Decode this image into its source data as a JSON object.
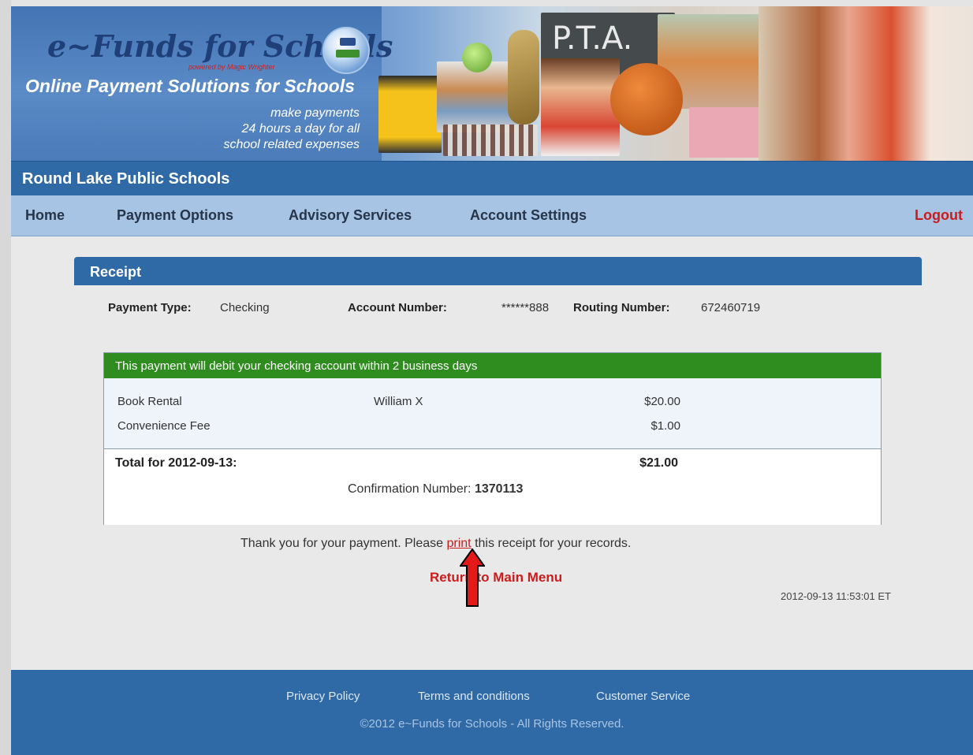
{
  "banner": {
    "logo_text": "e~Funds for Schools",
    "powered_by": "powered by Magic Wrighter",
    "tagline": "Online Payment Solutions for Schools",
    "subtitle_line1": "make payments",
    "subtitle_line2": "24 hours a day for all",
    "subtitle_line3": "school related expenses",
    "chalkboard_text": "P.T.A."
  },
  "school": {
    "name": "Round Lake Public Schools"
  },
  "nav": {
    "home": "Home",
    "payment_options": "Payment Options",
    "advisory_services": "Advisory Services",
    "account_settings": "Account Settings",
    "logout": "Logout"
  },
  "receipt": {
    "title": "Receipt",
    "payment_type_label": "Payment Type:",
    "payment_type_value": "Checking",
    "account_number_label": "Account Number:",
    "account_number_value": "******888",
    "routing_number_label": "Routing Number:",
    "routing_number_value": "672460719",
    "notice": "This payment will debit your checking account within 2 business days",
    "items": [
      {
        "name": "Book Rental",
        "student": "William X",
        "amount": "$20.00"
      },
      {
        "name": "Convenience Fee",
        "student": "",
        "amount": "$1.00"
      }
    ],
    "total_label": "Total for 2012-09-13:",
    "total_value": "$21.00",
    "confirmation_label": "Confirmation Number:",
    "confirmation_value": "1370113",
    "thanks_before": "Thank you for your payment. Please",
    "print_link": "print",
    "thanks_after": "this receipt for your records.",
    "return_link": "Return to Main Menu",
    "timestamp": "2012-09-13 11:53:01 ET"
  },
  "footer": {
    "privacy": "Privacy Policy",
    "terms": "Terms and conditions",
    "customer_service": "Customer Service",
    "copyright": "©2012 e~Funds for Schools - All Rights Reserved."
  },
  "colors": {
    "header_blue": "#2f6aa7",
    "nav_blue": "#a7c4e4",
    "notice_green": "#2f8c1f",
    "link_red": "#cc1b1b"
  }
}
